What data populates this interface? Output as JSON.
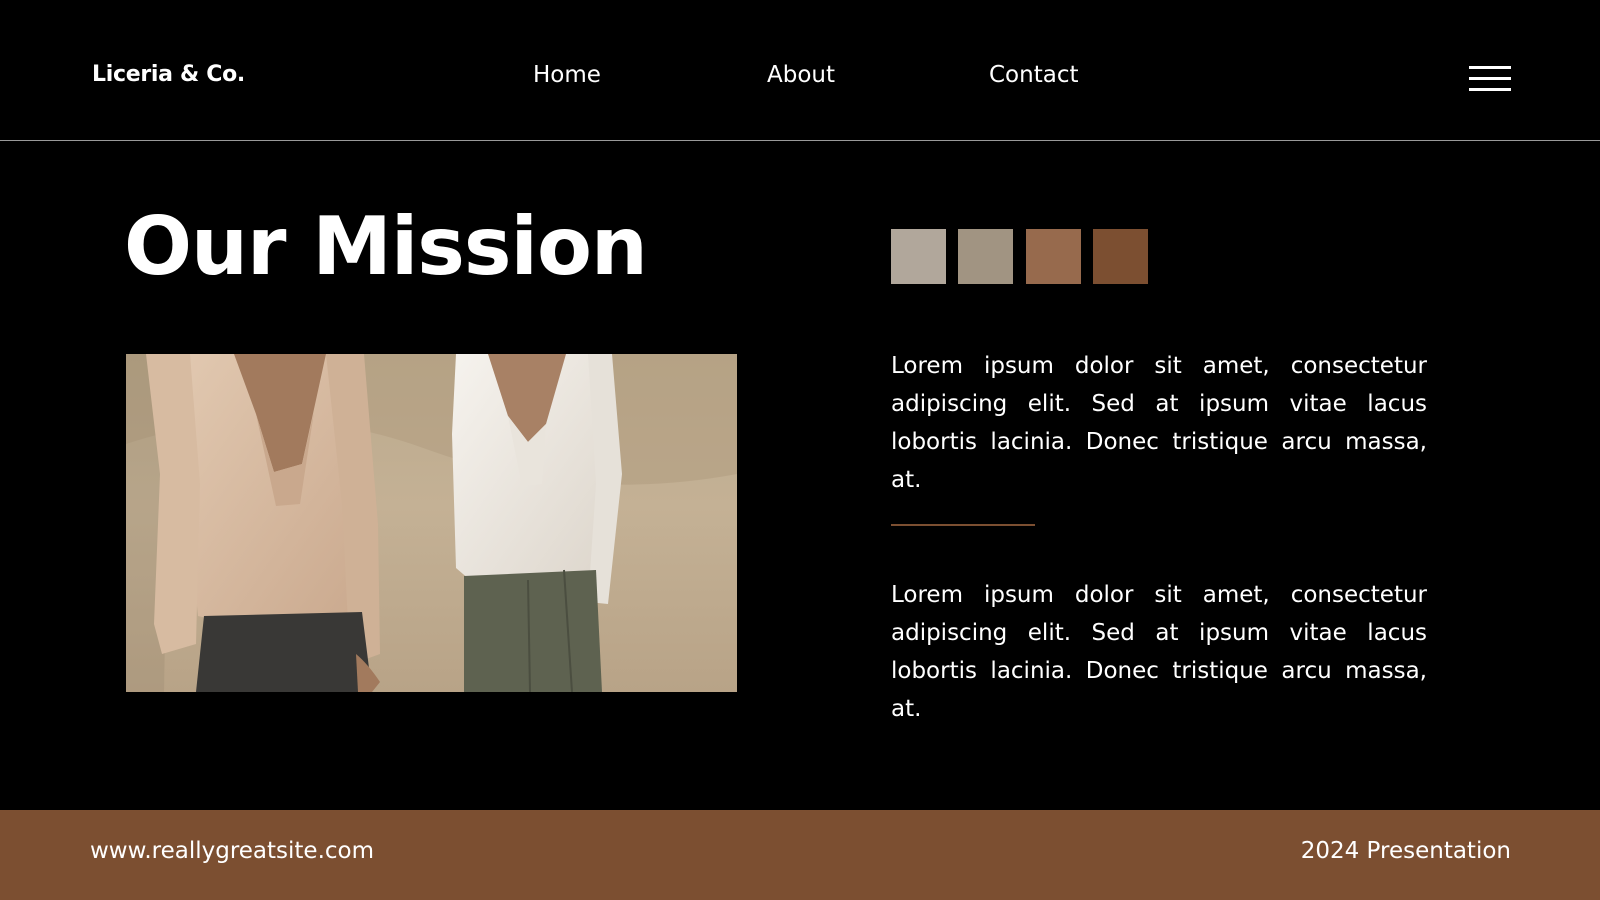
{
  "header": {
    "brand": "Liceria & Co.",
    "nav": [
      {
        "label": "Home"
      },
      {
        "label": "About"
      },
      {
        "label": "Contact"
      }
    ],
    "menu_icon": "hamburger-menu-icon"
  },
  "main": {
    "title": "Our Mission",
    "swatches": [
      "#b1a79b",
      "#a19482",
      "#976a4d",
      "#7c4f31"
    ],
    "paragraphs": [
      "Lorem ipsum dolor sit amet, consectetur adipiscing elit. Sed at ipsum vitae lacus lobortis lacinia. Donec tristique arcu massa, at.",
      "Lorem ipsum dolor sit amet, consectetur adipiscing elit. Sed at ipsum vitae lacus lobortis lacinia. Donec tristique arcu massa, at."
    ],
    "divider_color": "#7c4f31"
  },
  "footer": {
    "url": "www.reallygreatsite.com",
    "right_text": "2024 Presentation",
    "background": "#7c4f31"
  }
}
